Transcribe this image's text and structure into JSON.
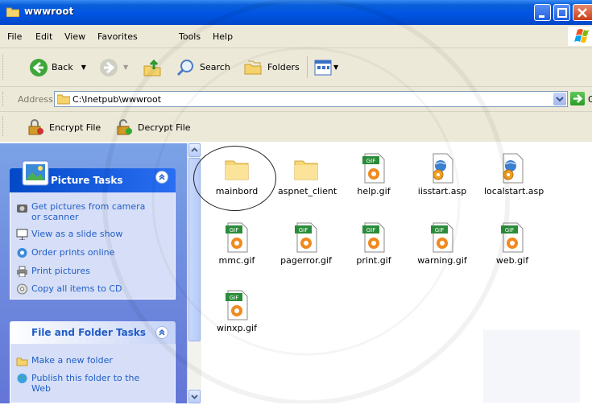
{
  "window": {
    "title": "wwwroot"
  },
  "menu": [
    "File",
    "Edit",
    "View",
    "Favorites",
    "Tools",
    "Help"
  ],
  "toolbar": {
    "back": "Back",
    "search": "Search",
    "folders": "Folders"
  },
  "address": {
    "label": "Address",
    "value": "C:\\Inetpub\\wwwroot",
    "go": "Go"
  },
  "encrypt_toolbar": {
    "encrypt": "Encrypt File",
    "decrypt": "Decrypt File"
  },
  "picture_tasks": {
    "title": "Picture Tasks",
    "items": [
      "Get pictures from camera or scanner",
      "View as a slide show",
      "Order prints online",
      "Print pictures",
      "Copy all items to CD"
    ]
  },
  "file_folder_tasks": {
    "title": "File and Folder Tasks",
    "items": [
      "Make a new folder",
      "Publish this folder to the Web"
    ]
  },
  "files": [
    {
      "name": "mainbord",
      "icon": "folder-icon"
    },
    {
      "name": "aspnet_client",
      "icon": "folder-icon"
    },
    {
      "name": "help.gif",
      "icon": "gif-file-icon"
    },
    {
      "name": "iisstart.asp",
      "icon": "asp-file-icon"
    },
    {
      "name": "localstart.asp",
      "icon": "asp-file-icon"
    },
    {
      "name": "mmc.gif",
      "icon": "gif-file-icon"
    },
    {
      "name": "pagerror.gif",
      "icon": "gif-file-icon"
    },
    {
      "name": "print.gif",
      "icon": "gif-file-icon"
    },
    {
      "name": "warning.gif",
      "icon": "gif-file-icon"
    },
    {
      "name": "web.gif",
      "icon": "gif-file-icon"
    },
    {
      "name": "winxp.gif",
      "icon": "gif-file-icon"
    }
  ],
  "gif_badge": "GIF",
  "colors": {
    "titlebar": "#0054e3",
    "taskpane": "#7ba2e7",
    "link": "#215dc6",
    "chrome": "#ece9d8"
  }
}
